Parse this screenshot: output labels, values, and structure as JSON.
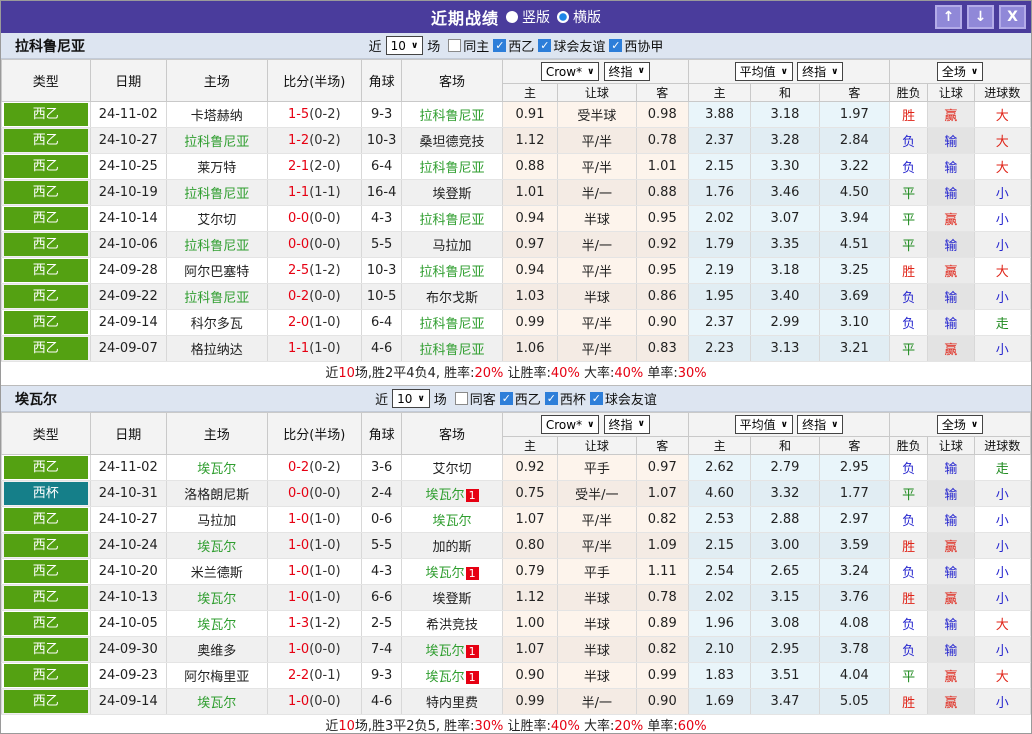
{
  "titlebar": {
    "title": "近期战绩",
    "radio_vertical": "竖版",
    "radio_horizontal": "横版",
    "up_icon": "↑",
    "down_icon": "↓",
    "close_icon": "X",
    "bar_color": "#4a3c9c"
  },
  "filter_labels": {
    "near": "近",
    "count": "10",
    "games": "场"
  },
  "table_header": {
    "type": "类型",
    "date": "日期",
    "home": "主场",
    "score": "比分(半场)",
    "corner": "角球",
    "away": "客场",
    "crow_select": "Crow*",
    "final_select": "终指",
    "avg_select": "平均值",
    "final_select2": "终指",
    "full_select": "全场",
    "h": "主",
    "handicap": "让球",
    "a": "客",
    "avg_h": "主",
    "avg_d": "和",
    "avg_a": "客",
    "wdl": "胜负",
    "let": "让球",
    "goals": "进球数"
  },
  "colors": {
    "league_green": "#54a112",
    "league_cup_teal": "#157f89",
    "team_highlight": "#2f9e2f",
    "score_red": "#e60012",
    "result_red": "#e02418",
    "result_blue": "#2727cf",
    "result_green": "#1e8a1e"
  },
  "sections": [
    {
      "team": "拉科鲁尼亚",
      "filters": [
        {
          "label": "同主",
          "checked": false
        },
        {
          "label": "西乙",
          "checked": true
        },
        {
          "label": "球会友谊",
          "checked": true
        },
        {
          "label": "西协甲",
          "checked": true
        }
      ],
      "rows": [
        {
          "league": "西乙",
          "date": "24-11-02",
          "home": "卡塔赫纳",
          "home_highlight": false,
          "score": "1-5",
          "half": "(0-2)",
          "corners": "9-3",
          "away": "拉科鲁尼亚",
          "away_highlight": true,
          "away_badge": "",
          "odds": [
            "0.91",
            "受半球",
            "0.98"
          ],
          "averages": [
            "3.88",
            "3.18",
            "1.97"
          ],
          "results": [
            "胜",
            "赢",
            "大"
          ]
        },
        {
          "league": "西乙",
          "date": "24-10-27",
          "home": "拉科鲁尼亚",
          "home_highlight": true,
          "score": "1-2",
          "half": "(0-2)",
          "corners": "10-3",
          "away": "桑坦德竞技",
          "away_highlight": false,
          "away_badge": "",
          "odds": [
            "1.12",
            "平/半",
            "0.78"
          ],
          "averages": [
            "2.37",
            "3.28",
            "2.84"
          ],
          "results": [
            "负",
            "输",
            "大"
          ]
        },
        {
          "league": "西乙",
          "date": "24-10-25",
          "home": "莱万特",
          "home_highlight": false,
          "score": "2-1",
          "half": "(2-0)",
          "corners": "6-4",
          "away": "拉科鲁尼亚",
          "away_highlight": true,
          "away_badge": "",
          "odds": [
            "0.88",
            "平/半",
            "1.01"
          ],
          "averages": [
            "2.15",
            "3.30",
            "3.22"
          ],
          "results": [
            "负",
            "输",
            "大"
          ]
        },
        {
          "league": "西乙",
          "date": "24-10-19",
          "home": "拉科鲁尼亚",
          "home_highlight": true,
          "score": "1-1",
          "half": "(1-1)",
          "corners": "16-4",
          "away": "埃登斯",
          "away_highlight": false,
          "away_badge": "",
          "odds": [
            "1.01",
            "半/一",
            "0.88"
          ],
          "averages": [
            "1.76",
            "3.46",
            "4.50"
          ],
          "results": [
            "平",
            "输",
            "小"
          ]
        },
        {
          "league": "西乙",
          "date": "24-10-14",
          "home": "艾尔切",
          "home_highlight": false,
          "score": "0-0",
          "half": "(0-0)",
          "corners": "4-3",
          "away": "拉科鲁尼亚",
          "away_highlight": true,
          "away_badge": "",
          "odds": [
            "0.94",
            "半球",
            "0.95"
          ],
          "averages": [
            "2.02",
            "3.07",
            "3.94"
          ],
          "results": [
            "平",
            "赢",
            "小"
          ]
        },
        {
          "league": "西乙",
          "date": "24-10-06",
          "home": "拉科鲁尼亚",
          "home_highlight": true,
          "score": "0-0",
          "half": "(0-0)",
          "corners": "5-5",
          "away": "马拉加",
          "away_highlight": false,
          "away_badge": "",
          "odds": [
            "0.97",
            "半/一",
            "0.92"
          ],
          "averages": [
            "1.79",
            "3.35",
            "4.51"
          ],
          "results": [
            "平",
            "输",
            "小"
          ]
        },
        {
          "league": "西乙",
          "date": "24-09-28",
          "home": "阿尔巴塞特",
          "home_highlight": false,
          "score": "2-5",
          "half": "(1-2)",
          "corners": "10-3",
          "away": "拉科鲁尼亚",
          "away_highlight": true,
          "away_badge": "",
          "odds": [
            "0.94",
            "平/半",
            "0.95"
          ],
          "averages": [
            "2.19",
            "3.18",
            "3.25"
          ],
          "results": [
            "胜",
            "赢",
            "大"
          ]
        },
        {
          "league": "西乙",
          "date": "24-09-22",
          "home": "拉科鲁尼亚",
          "home_highlight": true,
          "score": "0-2",
          "half": "(0-0)",
          "corners": "10-5",
          "away": "布尔戈斯",
          "away_highlight": false,
          "away_badge": "",
          "odds": [
            "1.03",
            "半球",
            "0.86"
          ],
          "averages": [
            "1.95",
            "3.40",
            "3.69"
          ],
          "results": [
            "负",
            "输",
            "小"
          ]
        },
        {
          "league": "西乙",
          "date": "24-09-14",
          "home": "科尔多瓦",
          "home_highlight": false,
          "score": "2-0",
          "half": "(1-0)",
          "corners": "6-4",
          "away": "拉科鲁尼亚",
          "away_highlight": true,
          "away_badge": "",
          "odds": [
            "0.99",
            "平/半",
            "0.90"
          ],
          "averages": [
            "2.37",
            "2.99",
            "3.10"
          ],
          "results": [
            "负",
            "输",
            "走"
          ]
        },
        {
          "league": "西乙",
          "date": "24-09-07",
          "home": "格拉纳达",
          "home_highlight": false,
          "score": "1-1",
          "half": "(1-0)",
          "corners": "4-6",
          "away": "拉科鲁尼亚",
          "away_highlight": true,
          "away_badge": "",
          "odds": [
            "1.06",
            "平/半",
            "0.83"
          ],
          "averages": [
            "2.23",
            "3.13",
            "3.21"
          ],
          "results": [
            "平",
            "赢",
            "小"
          ]
        }
      ],
      "summary": [
        {
          "text": "近"
        },
        {
          "text": "10",
          "red": true
        },
        {
          "text": "场,胜2平4负4, 胜率:"
        },
        {
          "text": "20%",
          "red": true
        },
        {
          "text": " 让胜率:"
        },
        {
          "text": "40%",
          "red": true
        },
        {
          "text": " 大率:"
        },
        {
          "text": "40%",
          "red": true
        },
        {
          "text": " 单率:"
        },
        {
          "text": "30%",
          "red": true
        }
      ]
    },
    {
      "team": "埃瓦尔",
      "filters": [
        {
          "label": "同客",
          "checked": false
        },
        {
          "label": "西乙",
          "checked": true
        },
        {
          "label": "西杯",
          "checked": true
        },
        {
          "label": "球会友谊",
          "checked": true
        }
      ],
      "rows": [
        {
          "league": "西乙",
          "date": "24-11-02",
          "home": "埃瓦尔",
          "home_highlight": true,
          "score": "0-2",
          "half": "(0-2)",
          "corners": "3-6",
          "away": "艾尔切",
          "away_highlight": false,
          "away_badge": "",
          "odds": [
            "0.92",
            "平手",
            "0.97"
          ],
          "averages": [
            "2.62",
            "2.79",
            "2.95"
          ],
          "results": [
            "负",
            "输",
            "走"
          ]
        },
        {
          "league": "西杯",
          "date": "24-10-31",
          "home": "洛格朗尼斯",
          "home_highlight": false,
          "score": "0-0",
          "half": "(0-0)",
          "corners": "2-4",
          "away": "埃瓦尔",
          "away_highlight": true,
          "away_badge": "1",
          "odds": [
            "0.75",
            "受半/一",
            "1.07"
          ],
          "averages": [
            "4.60",
            "3.32",
            "1.77"
          ],
          "results": [
            "平",
            "输",
            "小"
          ]
        },
        {
          "league": "西乙",
          "date": "24-10-27",
          "home": "马拉加",
          "home_highlight": false,
          "score": "1-0",
          "half": "(1-0)",
          "corners": "0-6",
          "away": "埃瓦尔",
          "away_highlight": true,
          "away_badge": "",
          "odds": [
            "1.07",
            "平/半",
            "0.82"
          ],
          "averages": [
            "2.53",
            "2.88",
            "2.97"
          ],
          "results": [
            "负",
            "输",
            "小"
          ]
        },
        {
          "league": "西乙",
          "date": "24-10-24",
          "home": "埃瓦尔",
          "home_highlight": true,
          "score": "1-0",
          "half": "(1-0)",
          "corners": "5-5",
          "away": "加的斯",
          "away_highlight": false,
          "away_badge": "",
          "odds": [
            "0.80",
            "平/半",
            "1.09"
          ],
          "averages": [
            "2.15",
            "3.00",
            "3.59"
          ],
          "results": [
            "胜",
            "赢",
            "小"
          ]
        },
        {
          "league": "西乙",
          "date": "24-10-20",
          "home": "米兰德斯",
          "home_highlight": false,
          "score": "1-0",
          "half": "(1-0)",
          "corners": "4-3",
          "away": "埃瓦尔",
          "away_highlight": true,
          "away_badge": "1",
          "odds": [
            "0.79",
            "平手",
            "1.11"
          ],
          "averages": [
            "2.54",
            "2.65",
            "3.24"
          ],
          "results": [
            "负",
            "输",
            "小"
          ]
        },
        {
          "league": "西乙",
          "date": "24-10-13",
          "home": "埃瓦尔",
          "home_highlight": true,
          "score": "1-0",
          "half": "(1-0)",
          "corners": "6-6",
          "away": "埃登斯",
          "away_highlight": false,
          "away_badge": "",
          "odds": [
            "1.12",
            "半球",
            "0.78"
          ],
          "averages": [
            "2.02",
            "3.15",
            "3.76"
          ],
          "results": [
            "胜",
            "赢",
            "小"
          ]
        },
        {
          "league": "西乙",
          "date": "24-10-05",
          "home": "埃瓦尔",
          "home_highlight": true,
          "score": "1-3",
          "half": "(1-2)",
          "corners": "2-5",
          "away": "希洪竞技",
          "away_highlight": false,
          "away_badge": "",
          "odds": [
            "1.00",
            "半球",
            "0.89"
          ],
          "averages": [
            "1.96",
            "3.08",
            "4.08"
          ],
          "results": [
            "负",
            "输",
            "大"
          ]
        },
        {
          "league": "西乙",
          "date": "24-09-30",
          "home": "奥维多",
          "home_highlight": false,
          "score": "1-0",
          "half": "(0-0)",
          "corners": "7-4",
          "away": "埃瓦尔",
          "away_highlight": true,
          "away_badge": "1",
          "odds": [
            "1.07",
            "半球",
            "0.82"
          ],
          "averages": [
            "2.10",
            "2.95",
            "3.78"
          ],
          "results": [
            "负",
            "输",
            "小"
          ]
        },
        {
          "league": "西乙",
          "date": "24-09-23",
          "home": "阿尔梅里亚",
          "home_highlight": false,
          "score": "2-2",
          "half": "(0-1)",
          "corners": "9-3",
          "away": "埃瓦尔",
          "away_highlight": true,
          "away_badge": "1",
          "odds": [
            "0.90",
            "半球",
            "0.99"
          ],
          "averages": [
            "1.83",
            "3.51",
            "4.04"
          ],
          "results": [
            "平",
            "赢",
            "大"
          ]
        },
        {
          "league": "西乙",
          "date": "24-09-14",
          "home": "埃瓦尔",
          "home_highlight": true,
          "score": "1-0",
          "half": "(0-0)",
          "corners": "4-6",
          "away": "特内里费",
          "away_highlight": false,
          "away_badge": "",
          "odds": [
            "0.99",
            "半/一",
            "0.90"
          ],
          "averages": [
            "1.69",
            "3.47",
            "5.05"
          ],
          "results": [
            "胜",
            "赢",
            "小"
          ]
        }
      ],
      "summary": [
        {
          "text": "近"
        },
        {
          "text": "10",
          "red": true
        },
        {
          "text": "场,胜3平2负5, 胜率:"
        },
        {
          "text": "30%",
          "red": true
        },
        {
          "text": " 让胜率:"
        },
        {
          "text": "40%",
          "red": true
        },
        {
          "text": " 大率:"
        },
        {
          "text": "20%",
          "red": true
        },
        {
          "text": " 单率:"
        },
        {
          "text": "60%",
          "red": true
        }
      ]
    }
  ]
}
